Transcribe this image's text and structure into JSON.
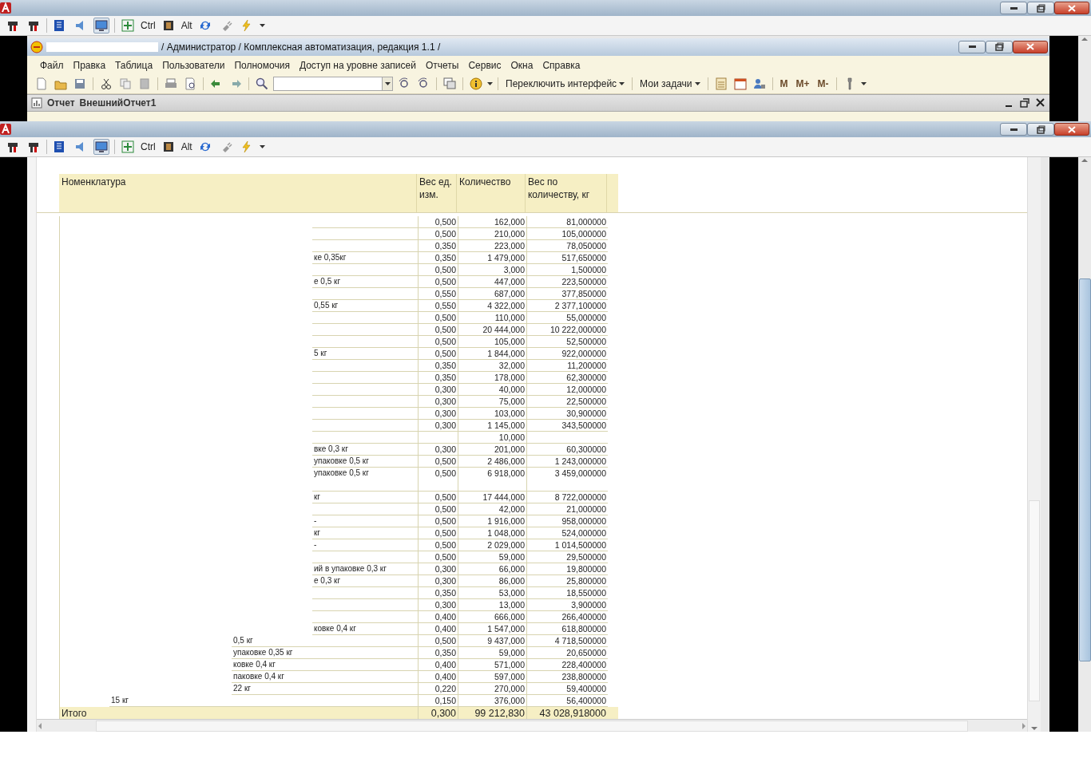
{
  "remote_bars": [
    {
      "ctrl": "Ctrl",
      "alt": "Alt",
      "display_pressed": true
    },
    {
      "ctrl": "Ctrl",
      "alt": "Alt",
      "display_pressed": true
    }
  ],
  "app_window": {
    "title": "/ Администратор /  Комплексная автоматизация, редакция 1.1 /",
    "menu": [
      "Файл",
      "Правка",
      "Таблица",
      "Пользователи",
      "Полномочия",
      "Доступ на уровне записей",
      "Отчеты",
      "Сервис",
      "Окна",
      "Справка"
    ],
    "toolbar": {
      "switch_interface": "Переключить интерфейс",
      "my_tasks": "Мои задачи",
      "memory_buttons": [
        "M",
        "M+",
        "M-"
      ]
    },
    "document": {
      "kind_label": "Отчет",
      "name": "ВнешнийОтчет1"
    }
  },
  "report": {
    "columns": [
      "Номенклатура",
      "Вес ед. изм.",
      "Количество",
      "Вес по количеству, кг"
    ],
    "rows": [
      {
        "kind": "wide",
        "weight": "0,500",
        "qty": "162,000",
        "total": "81,000000"
      },
      {
        "kind": "wide",
        "weight": "0,500",
        "qty": "210,000",
        "total": "105,000000"
      },
      {
        "kind": "wide",
        "weight": "0,350",
        "qty": "223,000",
        "total": "78,050000"
      },
      {
        "kind": "wide",
        "name": "ке 0,35кг",
        "weight": "0,350",
        "qty": "1 479,000",
        "total": "517,650000"
      },
      {
        "kind": "wide",
        "weight": "0,500",
        "qty": "3,000",
        "total": "1,500000"
      },
      {
        "kind": "wide",
        "name": "е 0,5 кг",
        "weight": "0,500",
        "qty": "447,000",
        "total": "223,500000"
      },
      {
        "kind": "wide",
        "weight": "0,550",
        "qty": "687,000",
        "total": "377,850000"
      },
      {
        "kind": "wide",
        "name": "0,55 кг",
        "weight": "0,550",
        "qty": "4 322,000",
        "total": "2 377,100000"
      },
      {
        "kind": "wide",
        "weight": "0,500",
        "qty": "110,000",
        "total": "55,000000"
      },
      {
        "kind": "wide",
        "weight": "0,500",
        "qty": "20 444,000",
        "total": "10 222,000000"
      },
      {
        "kind": "wide",
        "weight": "0,500",
        "qty": "105,000",
        "total": "52,500000"
      },
      {
        "kind": "wide",
        "name": "5 кг",
        "weight": "0,500",
        "qty": "1 844,000",
        "total": "922,000000"
      },
      {
        "kind": "wide",
        "weight": "0,350",
        "qty": "32,000",
        "total": "11,200000"
      },
      {
        "kind": "wide",
        "weight": "0,350",
        "qty": "178,000",
        "total": "62,300000"
      },
      {
        "kind": "wide",
        "weight": "0,300",
        "qty": "40,000",
        "total": "12,000000"
      },
      {
        "kind": "wide",
        "weight": "0,300",
        "qty": "75,000",
        "total": "22,500000"
      },
      {
        "kind": "wide",
        "weight": "0,300",
        "qty": "103,000",
        "total": "30,900000"
      },
      {
        "kind": "wide",
        "weight": "0,300",
        "qty": "1 145,000",
        "total": "343,500000"
      },
      {
        "kind": "wide",
        "qty": "10,000"
      },
      {
        "kind": "wide",
        "name": "вке 0,3 кг",
        "weight": "0,300",
        "qty": "201,000",
        "total": "60,300000"
      },
      {
        "kind": "wide",
        "name": "упаковке 0,5 кг",
        "weight": "0,500",
        "qty": "2 486,000",
        "total": "1 243,000000"
      },
      {
        "kind": "tall",
        "name": "упаковке 0,5 кг",
        "weight": "0,500",
        "qty": "6 918,000",
        "total": "3 459,000000"
      },
      {
        "kind": "wide",
        "name": "кг",
        "weight": "0,500",
        "qty": "17 444,000",
        "total": "8 722,000000"
      },
      {
        "kind": "wide",
        "weight": "0,500",
        "qty": "42,000",
        "total": "21,000000"
      },
      {
        "kind": "wide",
        "name": "-",
        "weight": "0,500",
        "qty": "1 916,000",
        "total": "958,000000"
      },
      {
        "kind": "wide",
        "name": "кг",
        "weight": "0,500",
        "qty": "1 048,000",
        "total": "524,000000"
      },
      {
        "kind": "wide",
        "name": "-",
        "weight": "0,500",
        "qty": "2 029,000",
        "total": "1 014,500000"
      },
      {
        "kind": "wide",
        "weight": "0,500",
        "qty": "59,000",
        "total": "29,500000"
      },
      {
        "kind": "wide",
        "name": "ий в упаковке 0,3 кг",
        "weight": "0,300",
        "qty": "66,000",
        "total": "19,800000"
      },
      {
        "kind": "wide",
        "name": "е 0,3 кг",
        "weight": "0,300",
        "qty": "86,000",
        "total": "25,800000"
      },
      {
        "kind": "wide",
        "weight": "0,350",
        "qty": "53,000",
        "total": "18,550000"
      },
      {
        "kind": "wide",
        "weight": "0,300",
        "qty": "13,000",
        "total": "3,900000"
      },
      {
        "kind": "wide",
        "weight": "0,400",
        "qty": "666,000",
        "total": "266,400000"
      },
      {
        "kind": "wide",
        "name": "ковке 0,4 кг",
        "weight": "0,400",
        "qty": "1 547,000",
        "total": "618,800000"
      },
      {
        "kind": "mid",
        "name": "0,5 кг",
        "weight": "0,500",
        "qty": "9 437,000",
        "total": "4 718,500000"
      },
      {
        "kind": "mid",
        "name": "упаковке 0,35 кг",
        "weight": "0,350",
        "qty": "59,000",
        "total": "20,650000"
      },
      {
        "kind": "mid",
        "name": "ковке 0,4 кг",
        "weight": "0,400",
        "qty": "571,000",
        "total": "228,400000"
      },
      {
        "kind": "mid",
        "name": "паковке 0,4 кг",
        "weight": "0,400",
        "qty": "597,000",
        "total": "238,800000"
      },
      {
        "kind": "mid",
        "name": "22 кг",
        "weight": "0,220",
        "qty": "270,000",
        "total": "59,400000"
      },
      {
        "kind": "narrow",
        "name": "15 кг",
        "weight": "0,150",
        "qty": "376,000",
        "total": "56,400000"
      }
    ],
    "total": {
      "label": "Итого",
      "weight": "0,300",
      "qty": "99 212,830",
      "total": "43 028,918000"
    }
  }
}
